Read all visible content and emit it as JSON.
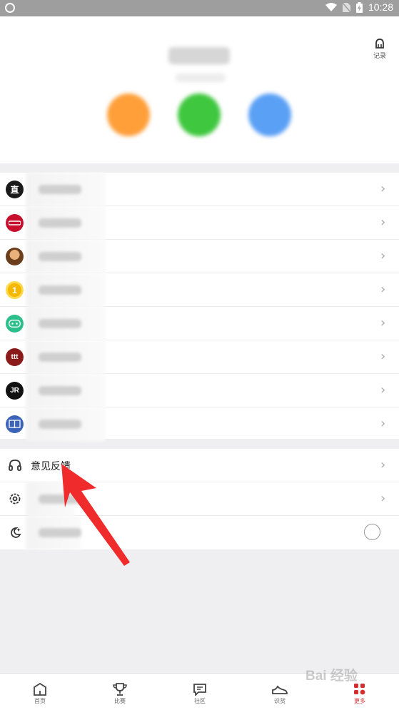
{
  "status_bar": {
    "time": "10:28"
  },
  "profile": {
    "record_label": "记录"
  },
  "app_list": [
    {
      "icon_text": "直",
      "color": "#1a1a1a"
    },
    {
      "icon_text": "",
      "color": "#c8102e"
    },
    {
      "icon_text": "",
      "color": "#b07a2a"
    },
    {
      "icon_text": "1",
      "color": "#f5b800"
    },
    {
      "icon_text": "",
      "color": "#2dbf8b"
    },
    {
      "icon_text": "ttt",
      "color": "#8b1a1a"
    },
    {
      "icon_text": "JR",
      "color": "#111111"
    },
    {
      "icon_text": "",
      "color": "#3b63b7"
    }
  ],
  "settings": {
    "feedback_label": "意见反馈"
  },
  "tabs": [
    {
      "label": "首页"
    },
    {
      "label": "比赛"
    },
    {
      "label": "社区"
    },
    {
      "label": "识货"
    },
    {
      "label": "更多"
    }
  ],
  "colors": {
    "accent": "#d32f2f",
    "arrow": "#f02b2b"
  }
}
